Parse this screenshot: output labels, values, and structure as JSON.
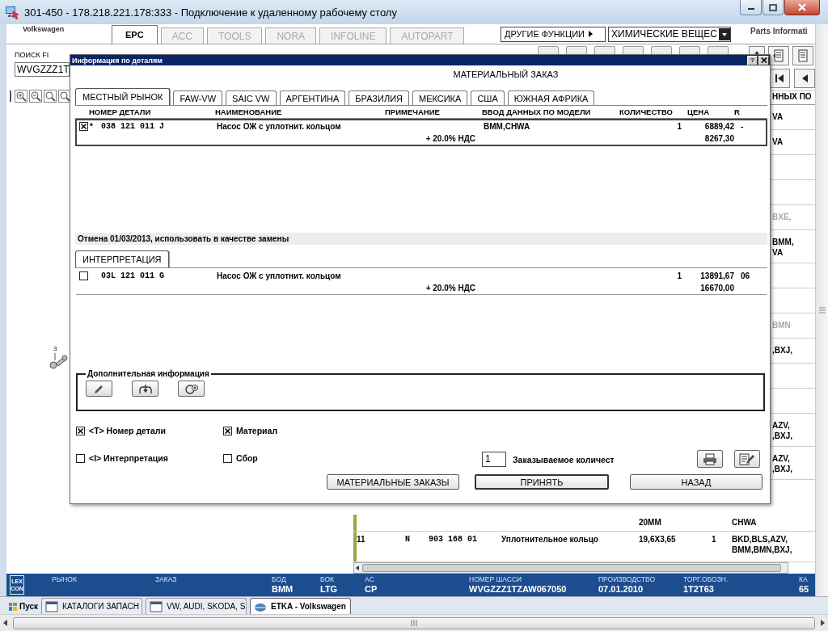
{
  "window": {
    "title": "301-450 - 178.218.221.178:333 - Подключение к удаленному рабочему столу"
  },
  "app": {
    "brand": "Volkswagen",
    "tabs": [
      {
        "label": "EPC",
        "selected": true,
        "disabled": false
      },
      {
        "label": "ACC",
        "selected": false,
        "disabled": true
      },
      {
        "label": "TOOLS",
        "selected": false,
        "disabled": true
      },
      {
        "label": "NORA",
        "selected": false,
        "disabled": true
      },
      {
        "label": "INFOLINE",
        "selected": false,
        "disabled": true
      },
      {
        "label": "AUTOPART",
        "selected": false,
        "disabled": true
      }
    ],
    "other_functions": "ДРУГИЕ ФУНКЦИИ",
    "function_dropdown": {
      "value": "ХИМИЧЕСКИЕ ВЕЩЕС"
    },
    "parts_info": "Parts Informati",
    "search": {
      "label": "ПОИСК FI",
      "value": "WVGZZZ1T"
    },
    "callout": "3"
  },
  "parts_table": {
    "header": "ННЫХ ПО",
    "side_rows": [
      {
        "kind": "text",
        "text": "VA",
        "dimmed": false
      },
      {
        "kind": "text",
        "text": "VA",
        "dimmed": false
      },
      {
        "kind": "blank"
      },
      {
        "kind": "blank"
      },
      {
        "kind": "text",
        "text": "BXE,",
        "dimmed": true
      },
      {
        "kind": "text",
        "text": "BMM,\nVA",
        "dimmed": false
      },
      {
        "kind": "blank"
      },
      {
        "kind": "blank"
      },
      {
        "kind": "text",
        "text": "BMN",
        "dimmed": true
      },
      {
        "kind": "text",
        "text": ",BXJ,",
        "dimmed": false
      },
      {
        "kind": "blank"
      },
      {
        "kind": "blank"
      },
      {
        "kind": "text",
        "text": "AZV,\n,BXJ,",
        "dimmed": false
      },
      {
        "kind": "text",
        "text": "AZV,\n,BXJ,",
        "dimmed": false
      }
    ],
    "rows": [
      {
        "size": "20MM",
        "models": "CHWA"
      },
      {
        "number": "11",
        "flag": "N",
        "part": "903 168 01",
        "name": "Уплотнительное кольцо",
        "size": "19,6X3,65",
        "qty": "1",
        "models": "BKD,BLS,AZV,\nBMM,BMN,BXJ,"
      }
    ]
  },
  "dialog": {
    "title": "Информация по деталям",
    "help": "?",
    "heading": "МАТЕРИАЛЬНЫЙ ЗАКАЗ",
    "market_tabs": [
      {
        "label": "МЕСТНЫЙ РЫНОК",
        "selected": true
      },
      {
        "label": "FAW-VW",
        "selected": false
      },
      {
        "label": "SAIC VW",
        "selected": false
      },
      {
        "label": "АРГЕНТИНА",
        "selected": false
      },
      {
        "label": "БРАЗИЛИЯ",
        "selected": false
      },
      {
        "label": "МЕКСИКА",
        "selected": false
      },
      {
        "label": "США",
        "selected": false
      },
      {
        "label": "ЮЖНАЯ АФРИКА",
        "selected": false
      }
    ],
    "columns": [
      "НОМЕР ДЕТАЛИ",
      "НАИМЕНОВАНИЕ",
      "ПРИМЕЧАНИЕ",
      "ВВОД ДАННЫХ ПО МОДЕЛИ",
      "КОЛИЧЕСТВО",
      "ЦЕНА",
      "R"
    ],
    "parts": [
      {
        "checked": true,
        "selected": true,
        "flag": "*",
        "number": "038 121 011 J",
        "name": "Насос ОЖ с уплотнит. кольцом",
        "models": "BMM,CHWA",
        "qty": "1",
        "price": "6889,42",
        "r": "-",
        "vat": "+ 20.0% НДС",
        "price_vat": "8267,30"
      }
    ],
    "replacement": {
      "notice": "Отмена 01/03/2013, использовать в качестве замены",
      "tab": {
        "label": "ИНТЕРПРЕТАЦИЯ",
        "selected": true
      },
      "parts": [
        {
          "checked": false,
          "selected": false,
          "number": "03L 121 011 G",
          "name": "Насос ОЖ с уплотнит. кольцом",
          "qty": "1",
          "price": "13891,67",
          "r": "06",
          "vat": "+ 20.0% НДС",
          "price_vat": "16670,00"
        }
      ]
    },
    "additional_info": {
      "legend": "Дополнительная информация"
    },
    "options": [
      {
        "label": "<T> Номер детали",
        "checked": true
      },
      {
        "label": "Материал",
        "checked": true
      },
      {
        "label": "<I> Интерпретация",
        "checked": false
      },
      {
        "label": "Сбор",
        "checked": false
      }
    ],
    "quantity": {
      "value": "1",
      "label": "Заказываемое количест"
    },
    "buttons": [
      {
        "label": "МАТЕРИАЛЬНЫЕ ЗАКАЗЫ",
        "default": false
      },
      {
        "label": "ПРИНЯТЬ",
        "default": true
      },
      {
        "label": "НАЗАД",
        "default": false
      }
    ]
  },
  "status_bar": {
    "logo": [
      "LEX",
      "CON"
    ],
    "items": [
      {
        "label": "РЫНОК"
      },
      {
        "label": "ЗАКАЗ"
      },
      {
        "label": "БОД",
        "value": "BMM"
      },
      {
        "label": "БОК",
        "value": "LTG"
      },
      {
        "label": "AC",
        "value": "CP"
      },
      {
        "label": "НОМЕР ШАССИ",
        "value": "WVGZZZ1TZAW067050"
      },
      {
        "label": "ПРОИЗВОДСТВО",
        "value": "07.01.2010"
      },
      {
        "label": "ТОРГ.ОБОЗН.",
        "value": "1T2T63"
      },
      {
        "label": "КА",
        "value": "65"
      }
    ]
  },
  "taskbar": {
    "start": "Пуск",
    "items": [
      {
        "label": "КАТАЛОГИ ЗАПАСН",
        "selected": false
      },
      {
        "label": "VW, AUDI, SKODA, S",
        "selected": false
      },
      {
        "label": "ETKA - Volkswagen",
        "selected": true
      }
    ]
  }
}
